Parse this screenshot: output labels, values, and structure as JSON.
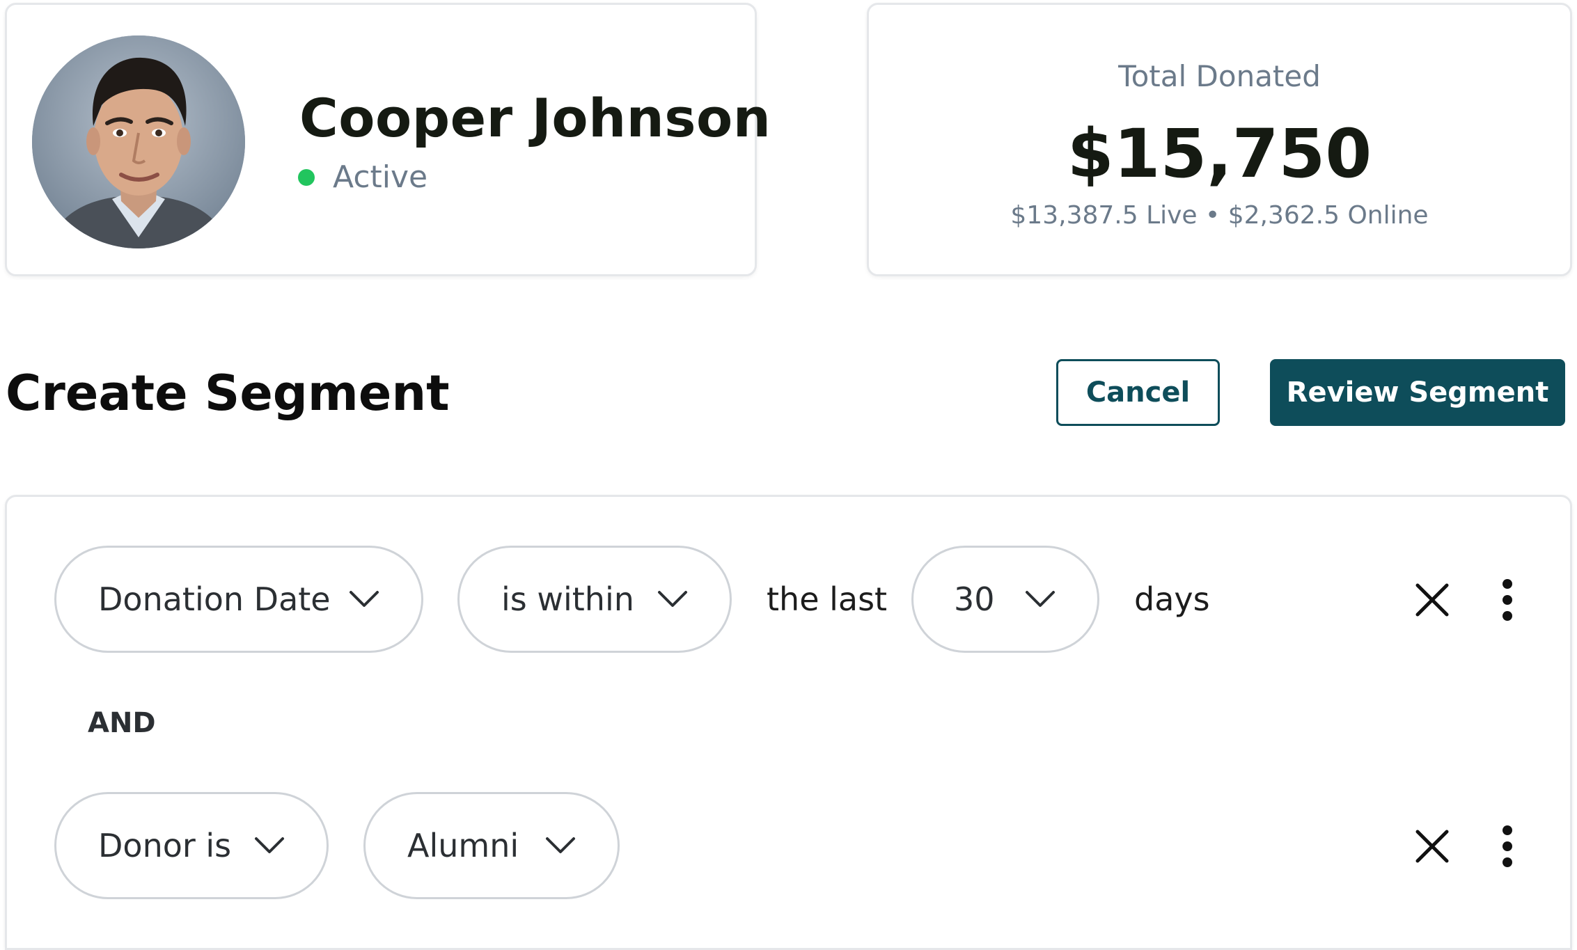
{
  "profile": {
    "name": "Cooper Johnson",
    "status": "Active",
    "status_color": "#22c55e"
  },
  "donations": {
    "label": "Total Donated",
    "total": "$15,750",
    "breakdown": "$13,387.5 Live • $2,362.5 Online"
  },
  "header": {
    "title": "Create Segment",
    "cancel_label": "Cancel",
    "review_label": "Review Segment",
    "accent_color": "#0e4d5a"
  },
  "rules": [
    {
      "field": "Donation Date",
      "operator": "is within",
      "text_before": "the last",
      "value": "30",
      "text_after": "days"
    },
    {
      "field": "Donor is",
      "value": "Alumni"
    }
  ],
  "connector": "AND",
  "icons": {
    "remove": "close-icon",
    "more": "kebab-menu-icon",
    "dropdown": "chevron-down-icon"
  }
}
